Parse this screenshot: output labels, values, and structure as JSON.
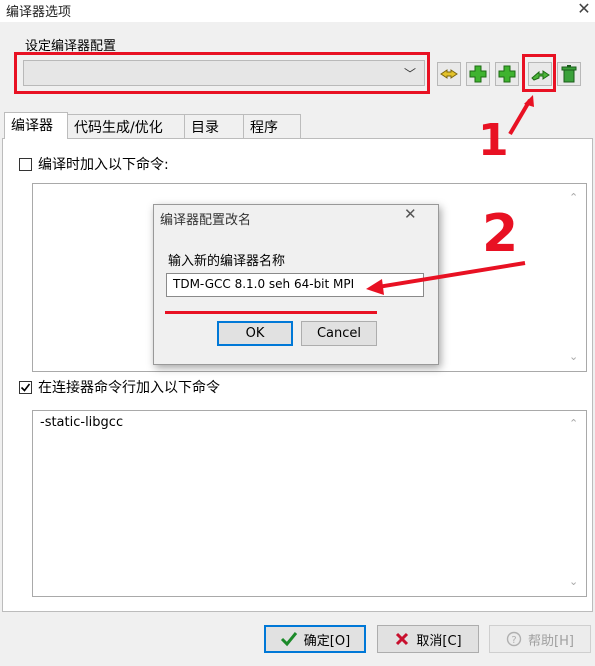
{
  "window": {
    "title": "编译器选项",
    "close_glyph": "✕"
  },
  "config_group": {
    "label": "设定编译器配置",
    "selected": ""
  },
  "toolbar_buttons": [
    {
      "name": "rename-config-button",
      "icon": "arrows-icon"
    },
    {
      "name": "add-config-button",
      "icon": "green-plus-icon"
    },
    {
      "name": "add-config-button-2",
      "icon": "green-plus-icon"
    },
    {
      "name": "rename-profile-button",
      "icon": "green-arrow-icon"
    },
    {
      "name": "delete-config-button",
      "icon": "trash-icon"
    }
  ],
  "tabs": [
    "编译器",
    "代码生成/优化",
    "目录",
    "程序"
  ],
  "compile_commands": {
    "label": "编译时加入以下命令:",
    "checked": false,
    "value": ""
  },
  "linker_commands": {
    "label": "在连接器命令行加入以下命令",
    "checked": true,
    "value": "-static-libgcc"
  },
  "dialog": {
    "title": "编译器配置改名",
    "close_glyph": "✕",
    "prompt": "输入新的编译器名称",
    "input_value": "TDM-GCC 8.1.0 seh 64-bit MPI",
    "ok_label": "OK",
    "cancel_label": "Cancel"
  },
  "annotations": {
    "one": "1",
    "two": "2",
    "color": "#e81123"
  },
  "footer": {
    "ok_label": "确定[O]",
    "cancel_label": "取消[C]",
    "help_label": "帮助[H]"
  }
}
